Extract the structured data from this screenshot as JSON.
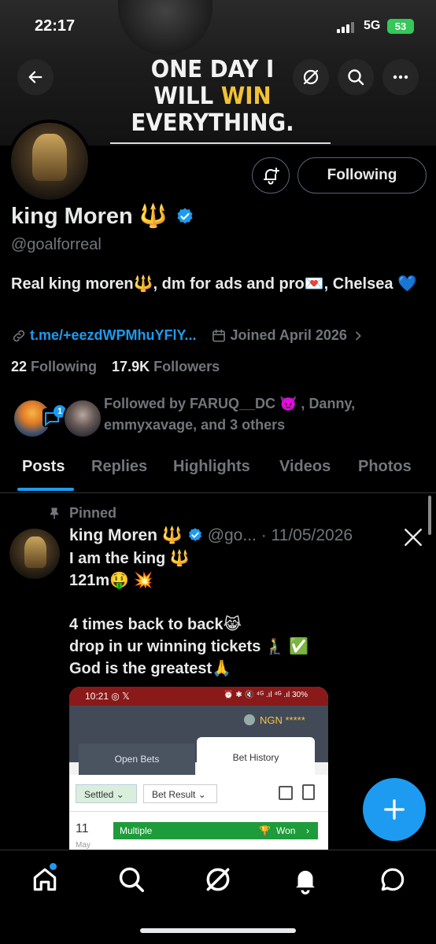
{
  "status_bar": {
    "time": "22:17",
    "network": "5G",
    "battery": "53"
  },
  "banner": {
    "line1": "ONE DAY I",
    "line2_a": "WILL ",
    "line2_b": "WIN",
    "line3": "EVERYTHING."
  },
  "header_icons": {
    "back": "back-arrow-icon",
    "grok": "grok-icon",
    "search": "search-icon",
    "more": "more-icon"
  },
  "profile": {
    "name": "king Moren 🔱",
    "handle": "@goalforreal",
    "bio": "Real king moren🔱, dm for ads and pro💌, Chelsea 💙",
    "link": "t.me/+eezdWPMhuYFlY...",
    "joined": "Joined April 2026",
    "following_count": "22",
    "following_label": "Following",
    "followers_count": "17.9K",
    "followers_label": "Followers",
    "followed_by": "Followed by FARUQ__DC 👿 , Danny, emmyxavage, and 3 others",
    "follow_button": "Following",
    "badge_count": "1"
  },
  "tabs": [
    "Posts",
    "Replies",
    "Highlights",
    "Videos",
    "Photos"
  ],
  "pinned_post": {
    "pinned_label": "Pinned",
    "author": "king Moren 🔱",
    "handle": "@go...",
    "date": "· 11/05/2026",
    "lines": [
      "I am the king 🔱",
      "121m🤑 💥",
      "",
      "4 times back to back😹",
      "drop in ur winning tickets 🧎‍♂️ ✅",
      "God is the greatest🙏"
    ]
  },
  "embed": {
    "time": "10:21 ◎ 𝕏",
    "status_right": "⏰ ✱ 🔇 ⁴ᴳ .ıl ⁴ᴳ .ıl 30%",
    "currency": "NGN *****",
    "tab_open": "Open Bets",
    "tab_history": "Bet History",
    "filter_settled": "Settled",
    "filter_result": "Bet Result",
    "day": "11",
    "month": "May",
    "bet_type": "Multiple",
    "bet_status": "Won"
  },
  "nav": [
    "home-icon",
    "search-icon",
    "grok-icon",
    "notifications-icon",
    "messages-icon"
  ],
  "colors": {
    "accent": "#1d9bf0",
    "verified": "#1d9bf0",
    "banner_win": "#f2c233",
    "won_green": "#1e9b3a"
  }
}
